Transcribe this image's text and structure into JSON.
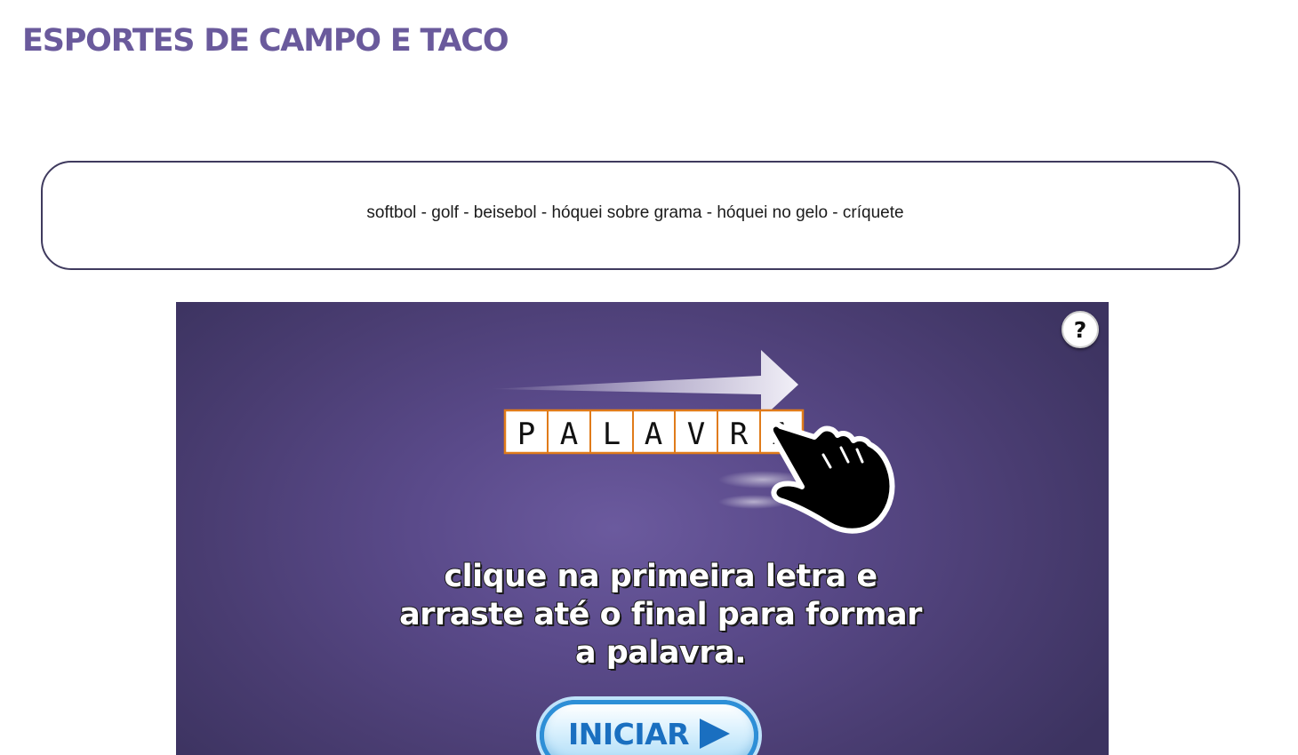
{
  "page": {
    "title": "ESPORTES DE CAMPO E TACO"
  },
  "word_box": {
    "text": "softbol - golf - beisebol - hóquei sobre grama - hóquei no gelo - críquete"
  },
  "game": {
    "help_label": "?",
    "demo_letters": [
      "P",
      "A",
      "L",
      "A",
      "V",
      "R",
      "A"
    ],
    "instruction": "clique na primeira letra e arraste até o final para formar a palavra.",
    "start_label": "INICIAR",
    "icons": {
      "help": "question-mark-icon",
      "hand": "pointing-hand-icon",
      "drag_arrow": "arrow-right-icon",
      "start_arrow": "play-triangle-icon"
    },
    "colors": {
      "title": "#6a5a9c",
      "background": "#5a4a8a",
      "tile_border": "#e07b1a",
      "start_text": "#1a6fc0",
      "start_border": "#2d8fd7"
    }
  }
}
